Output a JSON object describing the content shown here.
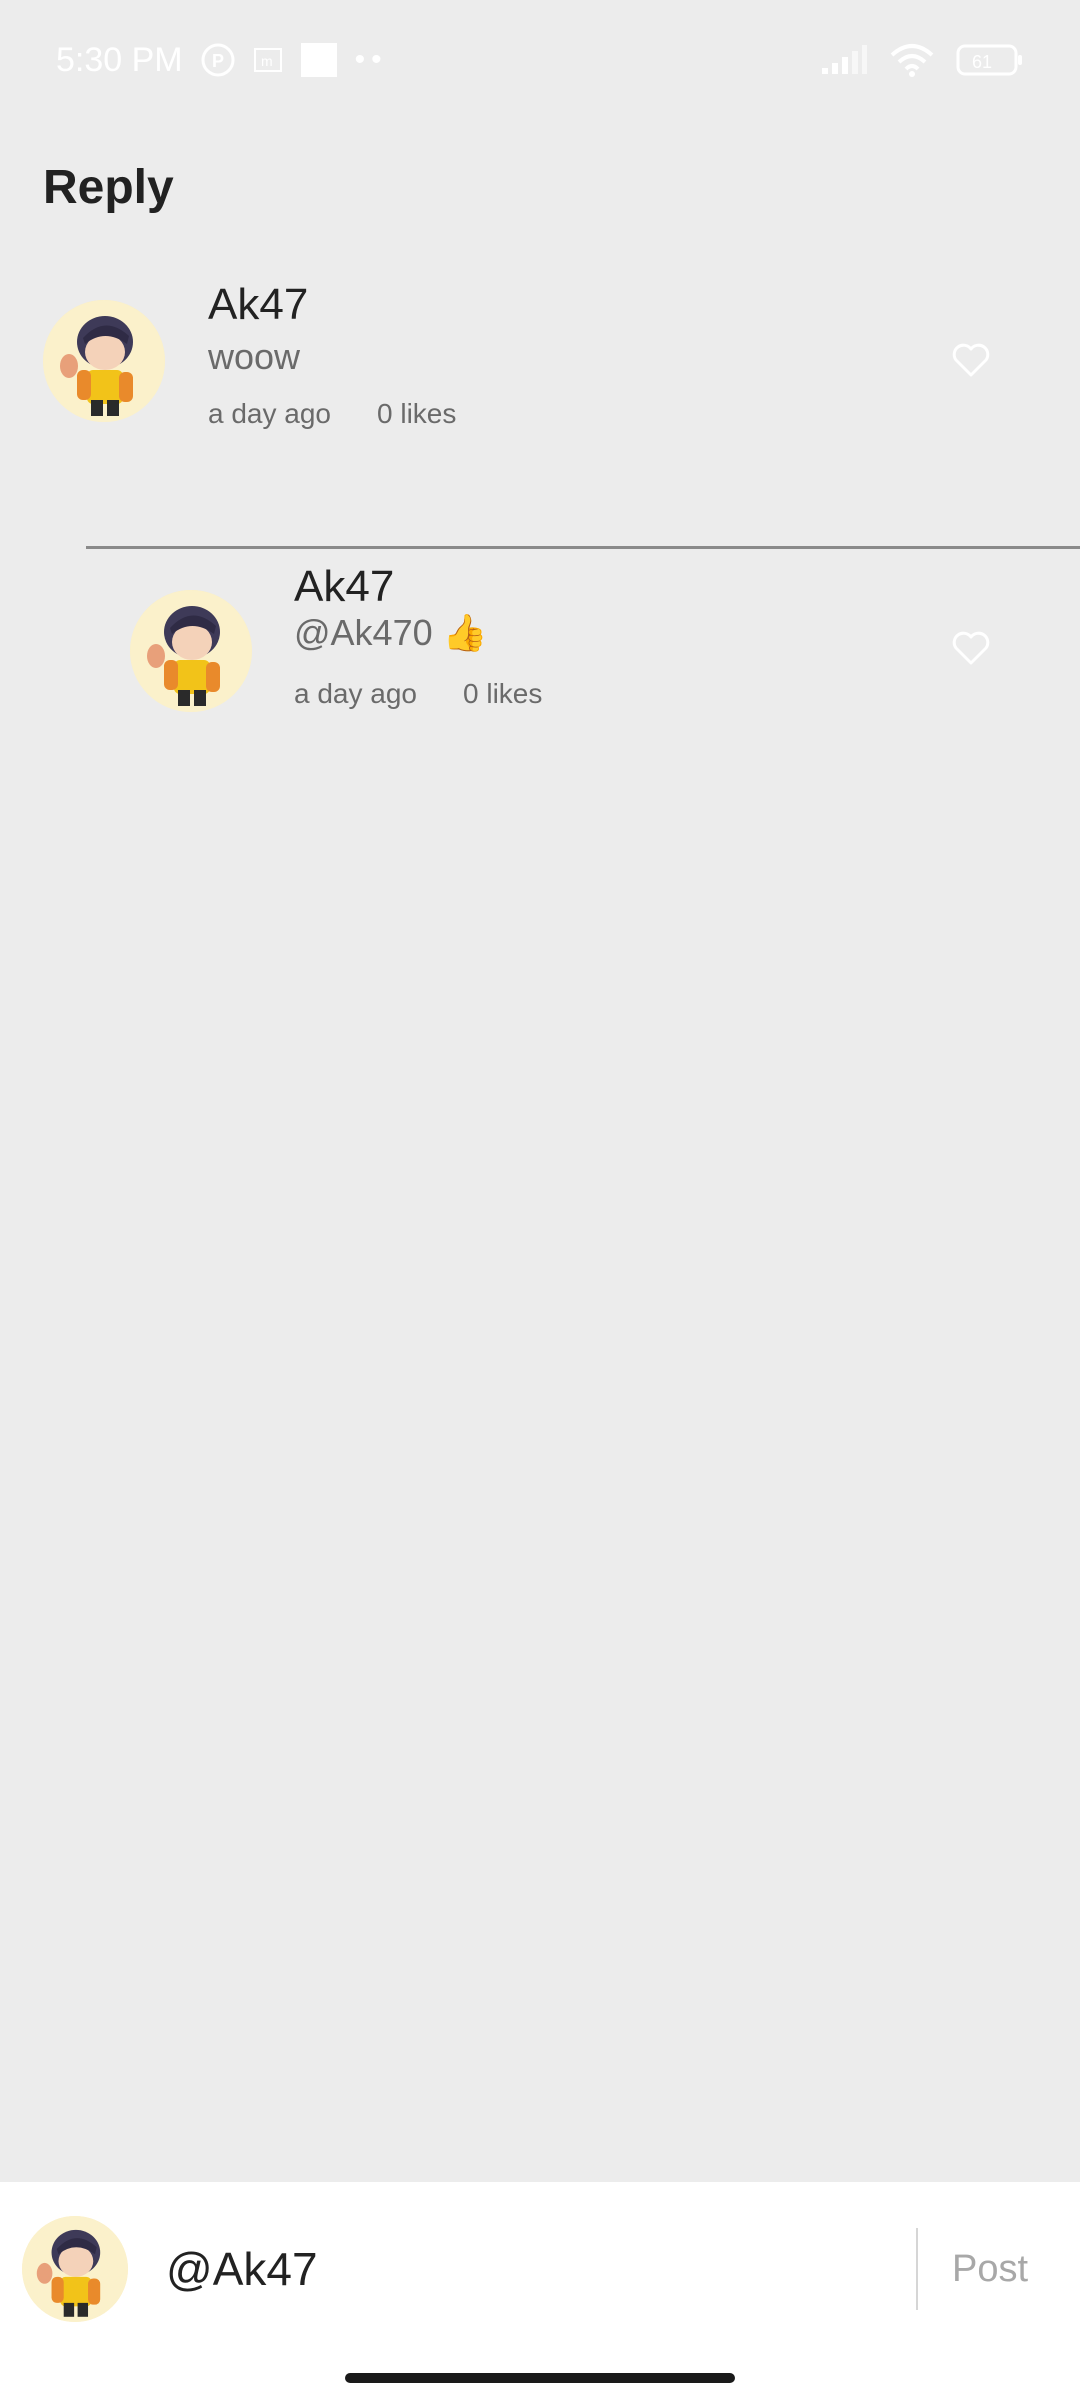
{
  "status_bar": {
    "time": "5:30 PM",
    "battery": "61",
    "icons": [
      "notification-p-icon",
      "notification-m-icon",
      "notification-square-icon",
      "more-dots-icon",
      "signal-icon",
      "wifi-icon",
      "battery-icon"
    ]
  },
  "page": {
    "title": "Reply"
  },
  "comments": [
    {
      "username": "Ak47",
      "text": "woow",
      "time": "a day ago",
      "likes": "0 likes"
    },
    {
      "username": "Ak47",
      "text": "@Ak470 👍",
      "time": "a day ago",
      "likes": "0 likes"
    }
  ],
  "composer": {
    "value": "@Ak47",
    "post_label": "Post"
  },
  "colors": {
    "background": "#ececec",
    "text_primary": "#222222",
    "text_secondary": "#6a6a6a",
    "post_disabled": "#a8a8a8"
  }
}
